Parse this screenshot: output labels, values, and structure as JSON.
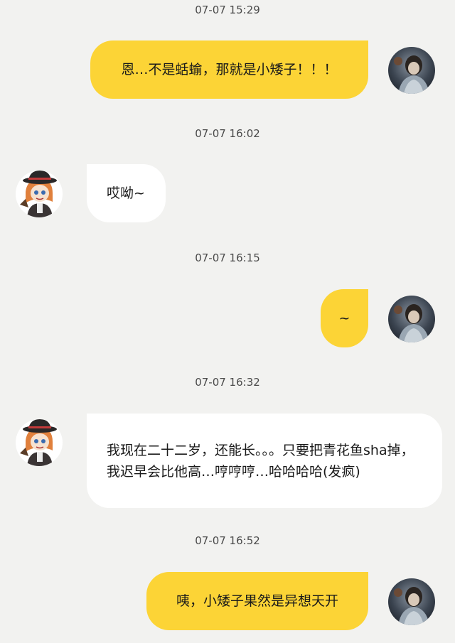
{
  "messages": [
    {
      "timestamp": "07-07 15:29",
      "sender": "me",
      "text": "恩…不是蛞蝓，那就是小矮子！！！"
    },
    {
      "timestamp": "07-07 16:02",
      "sender": "them",
      "text": "哎呦~"
    },
    {
      "timestamp": "07-07 16:15",
      "sender": "me",
      "text": "~"
    },
    {
      "timestamp": "07-07 16:32",
      "sender": "them",
      "text": "我现在二十二岁，还能长。。。只要把青花鱼sha掉，我迟早会比他高…哼哼哼…哈哈哈哈(发疯)"
    },
    {
      "timestamp": "07-07 16:52",
      "sender": "me",
      "text": "咦，小矮子果然是异想天开"
    }
  ],
  "avatars": {
    "me": "user-avatar-dark-anime-portrait",
    "them": "contact-avatar-orange-hair-hat-chibi"
  },
  "colors": {
    "background": "#f2f2f0",
    "my_bubble": "#fcd436",
    "their_bubble": "#ffffff",
    "timestamp_text": "#4a4a4a"
  }
}
